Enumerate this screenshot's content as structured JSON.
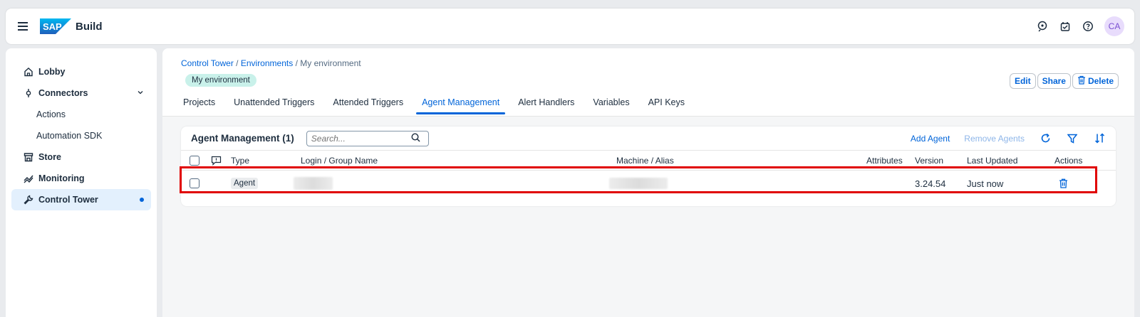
{
  "shell": {
    "product": "Build",
    "avatar_initials": "CA"
  },
  "sidebar": {
    "items": [
      {
        "label": "Lobby"
      },
      {
        "label": "Connectors"
      },
      {
        "label": "Actions"
      },
      {
        "label": "Automation SDK"
      },
      {
        "label": "Store"
      },
      {
        "label": "Monitoring"
      },
      {
        "label": "Control Tower"
      }
    ]
  },
  "header": {
    "breadcrumb": [
      "Control Tower",
      "Environments",
      "My environment"
    ],
    "separator": "/",
    "environment_badge": "My environment",
    "actions": {
      "edit": "Edit",
      "share": "Share",
      "delete": "Delete"
    }
  },
  "tabs": [
    {
      "label": "Projects"
    },
    {
      "label": "Unattended Triggers"
    },
    {
      "label": "Attended Triggers"
    },
    {
      "label": "Agent Management"
    },
    {
      "label": "Alert Handlers"
    },
    {
      "label": "Variables"
    },
    {
      "label": "API Keys"
    }
  ],
  "table": {
    "title": "Agent Management (1)",
    "search_placeholder": "Search...",
    "add_agent": "Add Agent",
    "remove_agents": "Remove Agents",
    "columns": {
      "type": "Type",
      "login": "Login / Group Name",
      "machine": "Machine / Alias",
      "attributes": "Attributes",
      "version": "Version",
      "last_updated": "Last Updated",
      "actions": "Actions"
    },
    "rows": [
      {
        "type": "Agent",
        "login": "",
        "machine": "",
        "attributes": "",
        "version": "3.24.54",
        "last_updated": "Just now"
      }
    ]
  },
  "colors": {
    "accent": "#0064d9",
    "highlight": "#e00000",
    "badge": "#c9f1ea"
  }
}
